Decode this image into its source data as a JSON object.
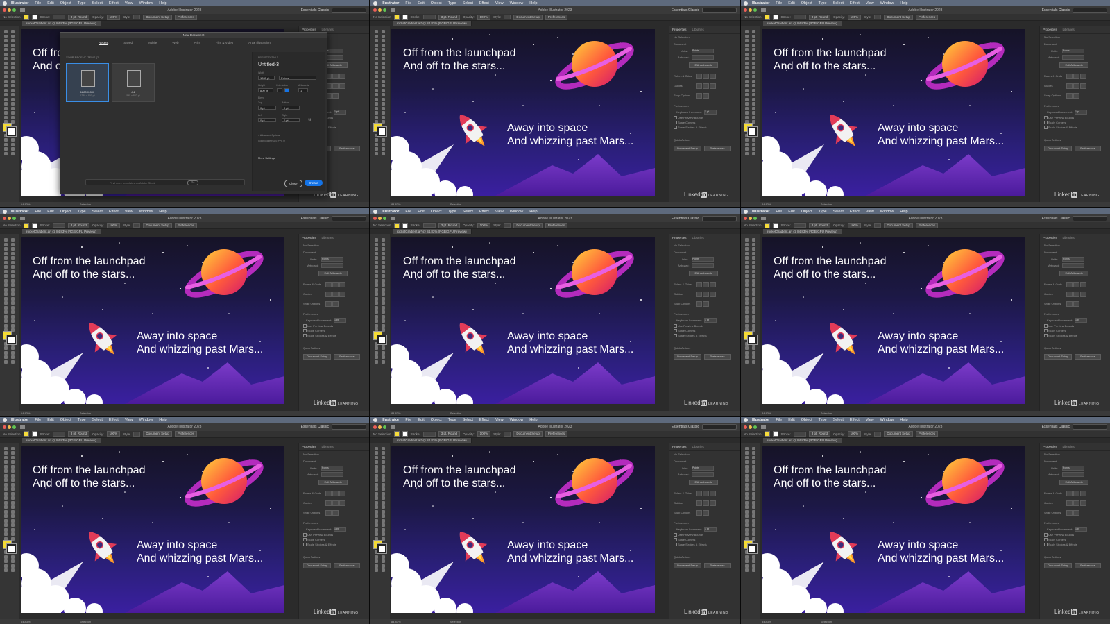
{
  "menubar": {
    "app_name": "Illustrator",
    "items": [
      "File",
      "Edit",
      "Object",
      "Type",
      "Select",
      "Effect",
      "View",
      "Window",
      "Help"
    ]
  },
  "window": {
    "title": "Adobe Illustrator 2023",
    "workspace": "Essentials Classic",
    "search_placeholder": "Search Adobe Stock"
  },
  "control_bar": {
    "selection": "No Selection",
    "stroke_label": "Stroke:",
    "stroke_value": "3 pt. Round",
    "opacity_label": "Opacity:",
    "opacity_value": "100%",
    "style_label": "Style:",
    "document_setup": "Document Setup",
    "preferences": "Preferences"
  },
  "document_tab": "rocketGradient.ai* @ 84.83% (RGB/GPU Preview)",
  "artwork": {
    "line1": "Off from the launchpad",
    "line2": "And off to the stars...",
    "line3": "Away into space",
    "line4": "And whizzing past Mars..."
  },
  "watermark": {
    "linked": "Linked",
    "in": "in",
    "learning": "LEARNING"
  },
  "properties_panel": {
    "tab_properties": "Properties",
    "tab_libraries": "Libraries",
    "no_selection": "No Selection",
    "document": "Document",
    "units_label": "Units:",
    "units_value": "Points",
    "artboard_label": "Artboard:",
    "edit_artboards": "Edit Artboards",
    "rulers_grids": "Rulers & Grids",
    "guides": "Guides",
    "snap_options": "Snap Options",
    "preferences": "Preferences",
    "keyboard_increment": "Keyboard Increment:",
    "keyboard_increment_value": "1 pt",
    "use_preview_bounds": "Use Preview Bounds",
    "scale_corners": "Scale Corners",
    "scale_strokes_effects": "Scale Strokes & Effects",
    "quick_actions": "Quick Actions",
    "document_setup_btn": "Document Setup",
    "preferences_btn": "Preferences"
  },
  "status_bar": {
    "zoom": "84.83%",
    "tool": "Selection"
  },
  "new_document_dialog": {
    "title": "New Document",
    "tabs": [
      "Recent",
      "Saved",
      "Mobile",
      "Web",
      "Print",
      "Film & Video",
      "Art & Illustration"
    ],
    "recent_items_label": "YOUR RECENT ITEMS (2)",
    "presets": [
      {
        "name": "1280 X 800",
        "size": "1280 x 800 pt"
      },
      {
        "name": "A4",
        "size": "595 x 842 pt"
      }
    ],
    "preset_details_label": "PRESET DETAILS",
    "doc_name": "Untitled-3",
    "width_label": "Width",
    "width_value": "1280 pt",
    "units_value": "Points",
    "height_label": "Height",
    "height_value": "800 pt",
    "orientation_label": "Orientation",
    "artboards_label": "Artboards",
    "artboards_value": "1",
    "bleed_label": "Bleed",
    "top_label": "Top",
    "bottom_label": "Bottom",
    "left_label": "Left",
    "right_label": "Right",
    "bleed_value": "0 pt",
    "advanced_options": "> Advanced Options",
    "color_mode": "Color Mode:RGB, PPI:72",
    "more_settings": "More Settings",
    "search_placeholder": "Find more templates on Adobe Stock",
    "go_label": "Go",
    "close_label": "Close",
    "create_label": "Create"
  },
  "colors": {
    "create_button": "#1473e6",
    "fill_swatch": "#f5dc35",
    "artboard_top": "#161327",
    "artboard_bottom": "#3a1fa0"
  }
}
